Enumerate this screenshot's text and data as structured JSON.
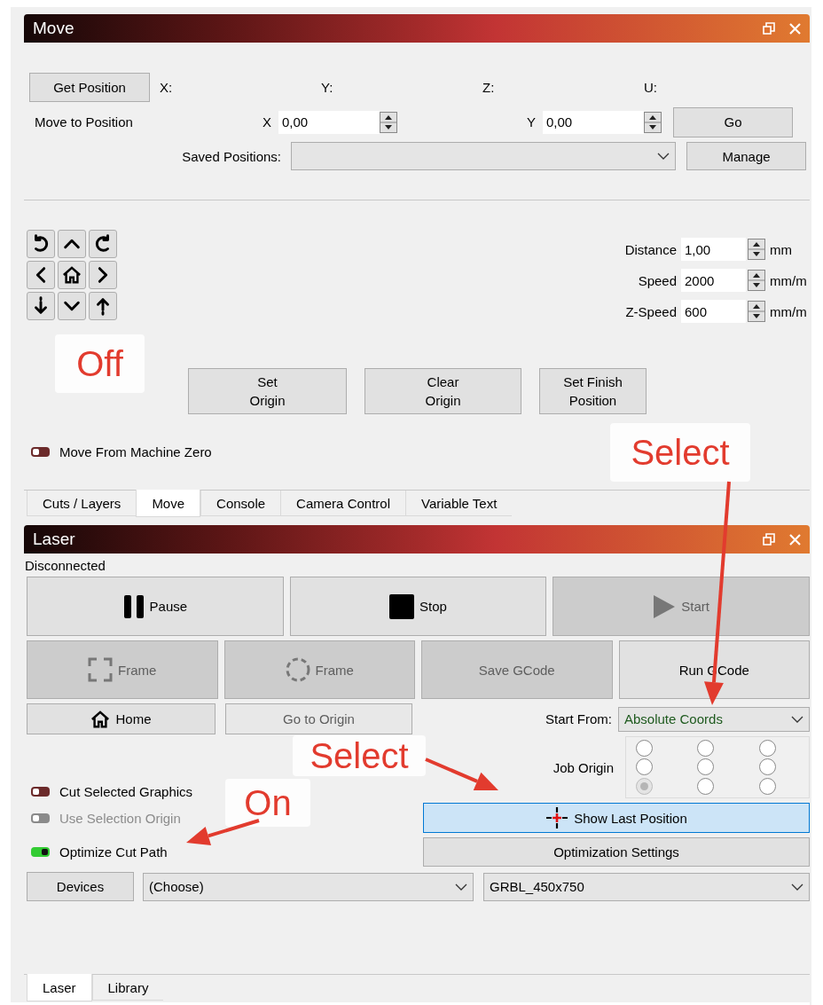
{
  "move_panel": {
    "title": "Move",
    "get_position_button": "Get Position",
    "axes": [
      "X:",
      "Y:",
      "Z:",
      "U:"
    ],
    "move_to_position": {
      "label": "Move to Position",
      "fields": [
        {
          "axis": "X",
          "value": "0,00"
        },
        {
          "axis": "Y",
          "value": "0,00"
        }
      ]
    },
    "go_button": "Go",
    "saved_positions": {
      "label": "Saved Positions:"
    },
    "manage_button": "Manage",
    "jog_settings": [
      {
        "label": "Distance",
        "value": "1,00",
        "unit": "mm"
      },
      {
        "label": "Speed",
        "value": "2000",
        "unit": "mm/m"
      },
      {
        "label": "Z-Speed",
        "value": "600",
        "unit": "mm/m"
      }
    ],
    "origin_buttons": [
      "Set\nOrigin",
      "Clear\nOrigin",
      "Set Finish\nPosition"
    ],
    "toggle": {
      "label": "Move From Machine Zero",
      "on": false,
      "disabled": false
    }
  },
  "dock_tabs": [
    {
      "label": "Cuts / Layers",
      "selected": false
    },
    {
      "label": "Move",
      "selected": true
    },
    {
      "label": "Console",
      "selected": false
    },
    {
      "label": "Camera Control",
      "selected": false
    },
    {
      "label": "Variable Text",
      "selected": false
    }
  ],
  "laser_panel": {
    "title": "Laser",
    "status": "Disconnected",
    "control_buttons": [
      {
        "label": "Pause",
        "kind": "pause",
        "disabled": false
      },
      {
        "label": "Stop",
        "kind": "stop",
        "disabled": false
      },
      {
        "label": "Start",
        "kind": "start",
        "disabled": true
      }
    ],
    "job_buttons": [
      {
        "label": "Frame",
        "kind": "rect-frame",
        "disabled": true
      },
      {
        "label": "Frame",
        "kind": "circle-frame",
        "disabled": true
      },
      {
        "label": "Save GCode",
        "kind": "plain",
        "disabled": true
      },
      {
        "label": "Run GCode",
        "kind": "plain",
        "disabled": false
      }
    ],
    "home_button": "Home",
    "go_to_origin_button": {
      "label": "Go to Origin",
      "disabled": true
    },
    "start_from": {
      "label": "Start From:",
      "value": "Absolute Coords"
    },
    "job_origin": {
      "label": "Job Origin",
      "options": [
        {
          "selected": false
        },
        {
          "selected": false
        },
        {
          "selected": false
        },
        {
          "selected": false
        },
        {
          "selected": false
        },
        {
          "selected": false
        },
        {
          "selected": true
        },
        {
          "selected": false
        },
        {
          "selected": false
        }
      ]
    },
    "toggles": [
      {
        "label": "Cut Selected Graphics",
        "on": false,
        "disabled": false
      },
      {
        "label": "Use Selection Origin",
        "on": false,
        "disabled": true
      },
      {
        "label": "Optimize Cut Path",
        "on": true,
        "disabled": false
      }
    ],
    "show_last_position_button": {
      "label": "Show Last Position",
      "selected": true
    },
    "optimization_settings_button": "Optimization Settings",
    "devices_button": "Devices",
    "device_select": "(Choose)",
    "profile_select": "GRBL_450x750"
  },
  "bottom_tabs": [
    {
      "label": "Laser",
      "selected": true
    },
    {
      "label": "Library",
      "selected": false
    }
  ],
  "annotations": [
    {
      "text": "Off"
    },
    {
      "text": "Select"
    },
    {
      "text": "Select"
    },
    {
      "text": "On"
    }
  ]
}
